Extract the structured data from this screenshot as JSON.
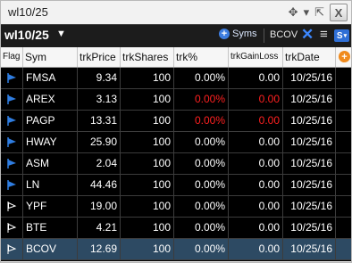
{
  "window": {
    "title": "wl10/25"
  },
  "toolbar": {
    "watchlist_name": "wl10/25",
    "syms_label": "Syms",
    "symbol_link": "BCOV",
    "s_label": "S"
  },
  "columns": [
    "Flag",
    "Sym",
    "trkPrice",
    "trkShares",
    "trk%",
    "trkGainLoss",
    "trkDate"
  ],
  "rows": [
    {
      "flag": "filled",
      "sym": "FMSA",
      "price": "9.34",
      "shares": "100",
      "pct": "0.00%",
      "gl": "0.00",
      "date": "10/25/16",
      "negative": false
    },
    {
      "flag": "filled",
      "sym": "AREX",
      "price": "3.13",
      "shares": "100",
      "pct": "0.00%",
      "gl": "0.00",
      "date": "10/25/16",
      "negative": true
    },
    {
      "flag": "filled",
      "sym": "PAGP",
      "price": "13.31",
      "shares": "100",
      "pct": "0.00%",
      "gl": "0.00",
      "date": "10/25/16",
      "negative": true
    },
    {
      "flag": "filled",
      "sym": "HWAY",
      "price": "25.90",
      "shares": "100",
      "pct": "0.00%",
      "gl": "0.00",
      "date": "10/25/16",
      "negative": false
    },
    {
      "flag": "filled",
      "sym": "ASM",
      "price": "2.04",
      "shares": "100",
      "pct": "0.00%",
      "gl": "0.00",
      "date": "10/25/16",
      "negative": false
    },
    {
      "flag": "filled",
      "sym": "LN",
      "price": "44.46",
      "shares": "100",
      "pct": "0.00%",
      "gl": "0.00",
      "date": "10/25/16",
      "negative": false
    },
    {
      "flag": "outline",
      "sym": "YPF",
      "price": "19.00",
      "shares": "100",
      "pct": "0.00%",
      "gl": "0.00",
      "date": "10/25/16",
      "negative": false
    },
    {
      "flag": "outline",
      "sym": "BTE",
      "price": "4.21",
      "shares": "100",
      "pct": "0.00%",
      "gl": "0.00",
      "date": "10/25/16",
      "negative": false
    },
    {
      "flag": "outline",
      "sym": "BCOV",
      "price": "12.69",
      "shares": "100",
      "pct": "0.00%",
      "gl": "0.00",
      "date": "10/25/16",
      "negative": false,
      "selected": true
    }
  ],
  "colors": {
    "flag_filled": "#2f7de1",
    "negative": "#ff2020",
    "selected_row": "#2d4a63"
  },
  "icons": {
    "move": "move-arrows-icon",
    "dropdown": "chevron-down-icon",
    "popout": "popout-icon",
    "close": "close-icon"
  }
}
